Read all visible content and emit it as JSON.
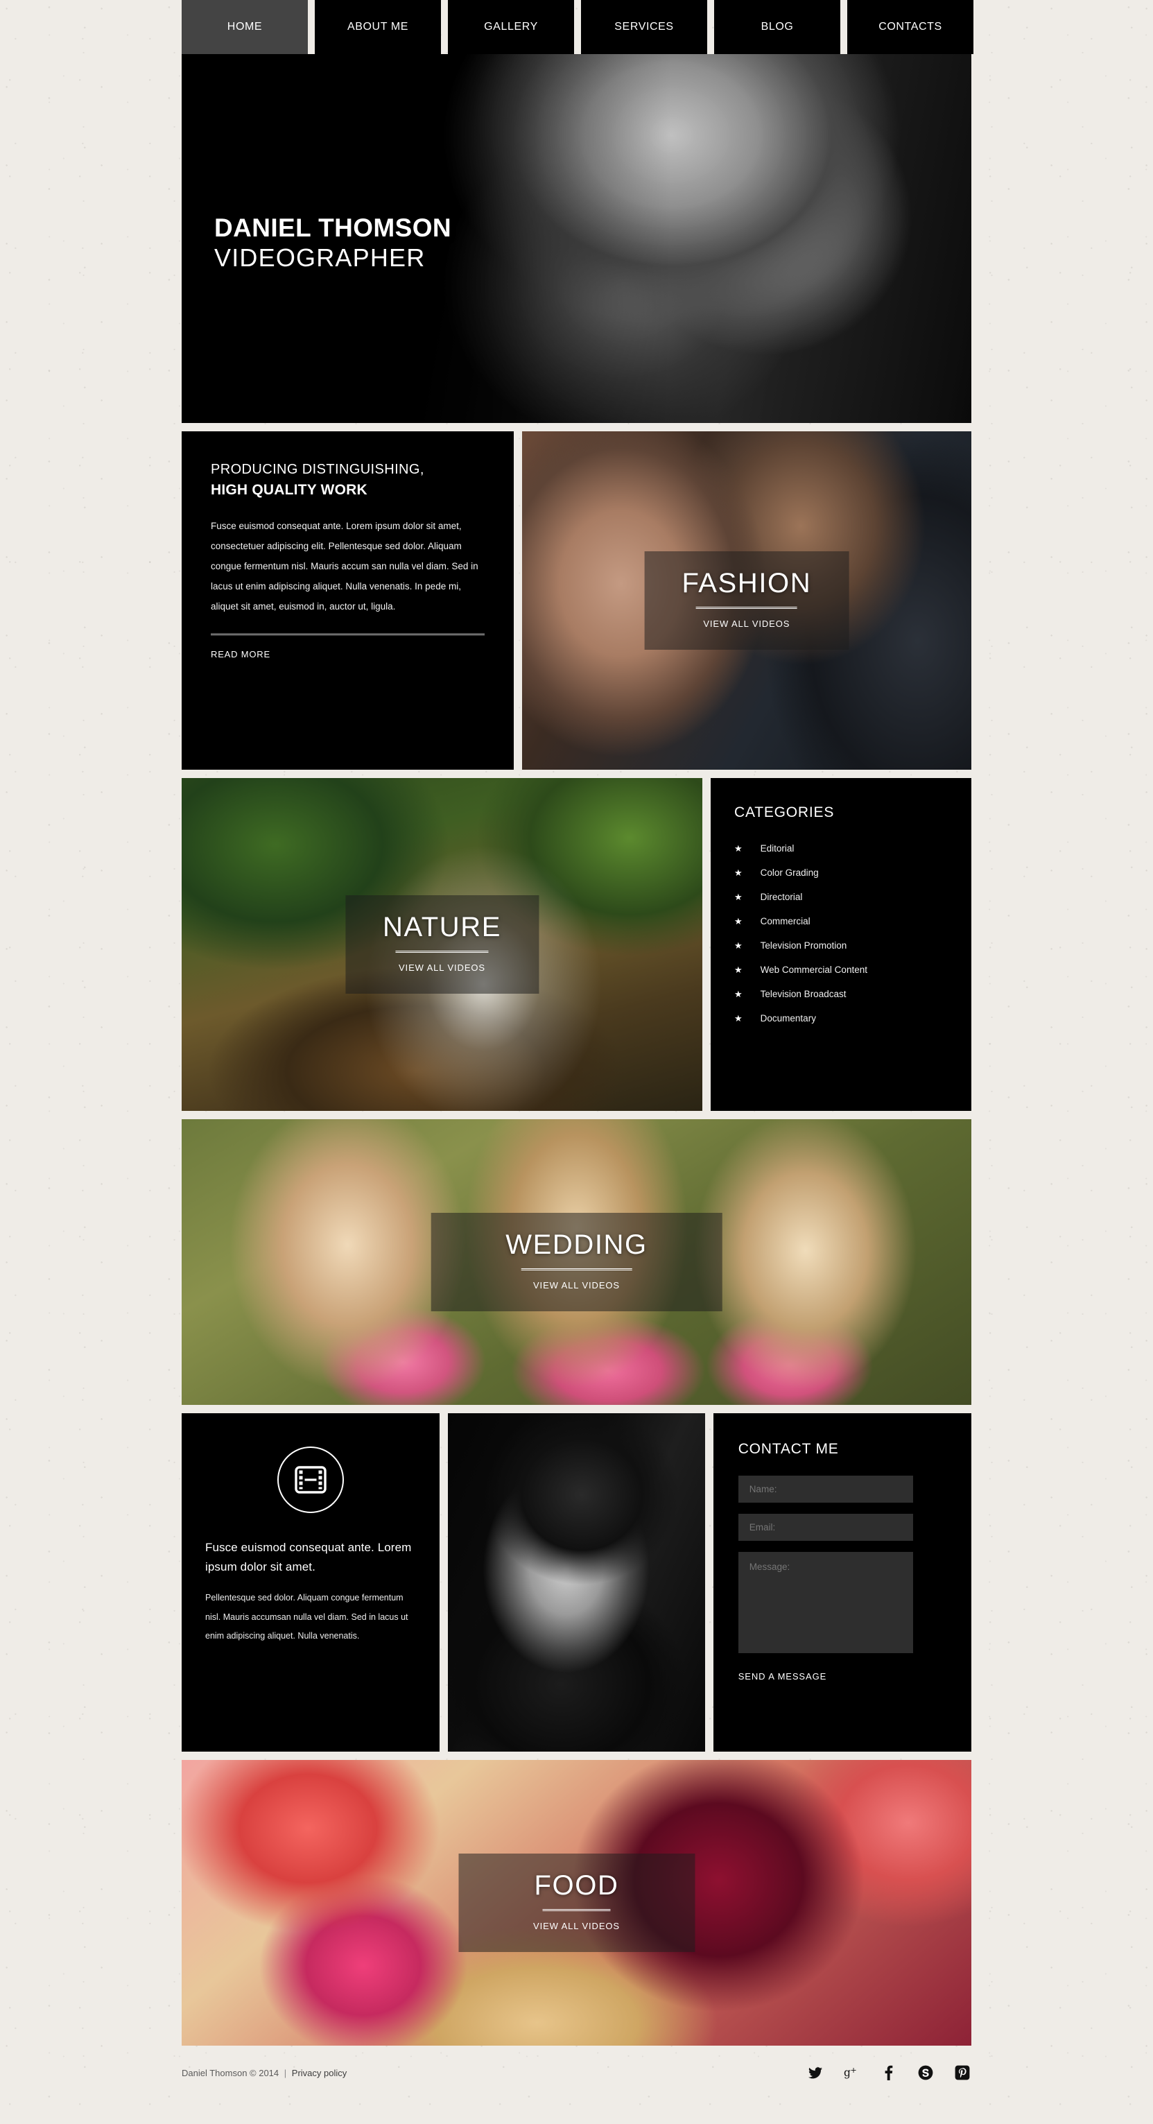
{
  "nav": {
    "items": [
      {
        "label": "HOME",
        "active": true
      },
      {
        "label": "ABOUT ME",
        "active": false
      },
      {
        "label": "GALLERY",
        "active": false
      },
      {
        "label": "SERVICES",
        "active": false
      },
      {
        "label": "BLOG",
        "active": false
      },
      {
        "label": "CONTACTS",
        "active": false
      }
    ]
  },
  "hero": {
    "title": "DANIEL THOMSON",
    "subtitle": "VIDEOGRAPHER"
  },
  "about": {
    "kicker": "PRODUCING DISTINGUISHING,",
    "heading": "HIGH QUALITY WORK",
    "body": "Fusce euismod consequat ante. Lorem ipsum dolor sit amet, consectetuer adipiscing elit. Pellentesque sed dolor. Aliquam congue fermentum nisl. Mauris accum san nulla vel diam. Sed in lacus ut enim adipiscing aliquet. Nulla venenatis. In pede mi, aliquet sit amet, euismod in, auctor ut, ligula.",
    "read_more": "READ MORE"
  },
  "tiles": {
    "fashion": {
      "title": "FASHION",
      "link": "VIEW ALL VIDEOS"
    },
    "nature": {
      "title": "NATURE",
      "link": "VIEW ALL VIDEOS"
    },
    "wedding": {
      "title": "WEDDING",
      "link": "VIEW ALL VIDEOS"
    },
    "food": {
      "title": "FOOD",
      "link": "VIEW ALL VIDEOS"
    }
  },
  "categories": {
    "title": "CATEGORIES",
    "items": [
      {
        "label": "Editorial"
      },
      {
        "label": "Color Grading"
      },
      {
        "label": "Directorial"
      },
      {
        "label": "Commercial"
      },
      {
        "label": "Television Promotion"
      },
      {
        "label": "Web Commercial Content"
      },
      {
        "label": "Television Broadcast"
      },
      {
        "label": "Documentary"
      }
    ],
    "bullet": "★"
  },
  "info": {
    "lead": "Fusce euismod consequat ante. Lorem ipsum dolor sit amet.",
    "body": "Pellentesque sed dolor. Aliquam congue fermentum nisl. Mauris accumsan nulla vel diam. Sed in lacus ut enim adipiscing aliquet. Nulla venenatis."
  },
  "contact": {
    "title": "CONTACT ME",
    "name_placeholder": "Name:",
    "name_value": "",
    "email_placeholder": "Email:",
    "email_value": "",
    "message_placeholder": "Message:",
    "message_value": "",
    "submit_label": "SEND A MESSAGE"
  },
  "footer": {
    "copyright": "Daniel Thomson © 2014",
    "separator": "|",
    "privacy": "Privacy policy",
    "socials": [
      {
        "name": "twitter-icon",
        "glyph": "t"
      },
      {
        "name": "google-plus-icon",
        "glyph": "g+"
      },
      {
        "name": "facebook-icon",
        "glyph": "f"
      },
      {
        "name": "skype-icon",
        "glyph": "S"
      },
      {
        "name": "pinterest-icon",
        "glyph": "P"
      }
    ]
  },
  "colors": {
    "page_background": "#efece7",
    "panel": "#000000",
    "nav_active": "#444444",
    "field": "#2e2e2e",
    "text": "#ffffff",
    "footer_text": "#5a5a5a"
  }
}
